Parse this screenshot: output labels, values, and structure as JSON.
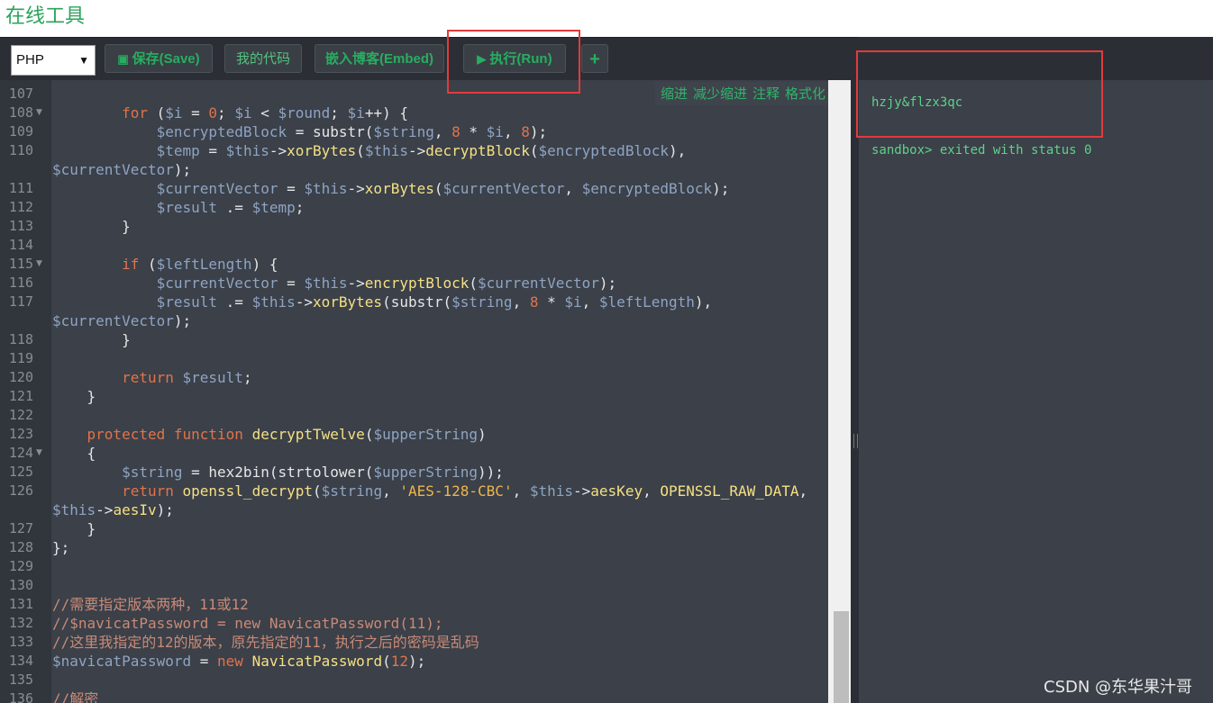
{
  "header": {
    "site_title": "在线工具"
  },
  "toolbar": {
    "language_selected": "PHP",
    "save_label": "保存(Save)",
    "mycode_label": "我的代码",
    "embed_label": "嵌入博客(Embed)",
    "run_label": "执行(Run)",
    "add_label": "+"
  },
  "editor_tools": [
    "缩进",
    "减少缩进",
    "注释",
    "格式化"
  ],
  "editor": {
    "lines": [
      {
        "n": "107",
        "fold": false,
        "html": ""
      },
      {
        "n": "108",
        "fold": true,
        "html": "        <span class=\"kw\">for</span> (<span class=\"var\">$i</span> = <span class=\"num\">0</span>; <span class=\"var\">$i</span> &lt; <span class=\"var\">$round</span>; <span class=\"var\">$i</span>++) {"
      },
      {
        "n": "109",
        "fold": false,
        "html": "            <span class=\"var\">$encryptedBlock</span> = substr(<span class=\"var\">$string</span>, <span class=\"num\">8</span> * <span class=\"var\">$i</span>, <span class=\"num\">8</span>);"
      },
      {
        "n": "110",
        "fold": false,
        "html": "            <span class=\"var\">$temp</span> = <span class=\"var\">$this</span>-&gt;<span class=\"fn\">xorBytes</span>(<span class=\"var\">$this</span>-&gt;<span class=\"fn\">decryptBlock</span>(<span class=\"var\">$encryptedBlock</span>),"
      },
      {
        "n": "",
        "fold": false,
        "html": "<span class=\"var\">$currentVector</span>);"
      },
      {
        "n": "111",
        "fold": false,
        "html": "            <span class=\"var\">$currentVector</span> = <span class=\"var\">$this</span>-&gt;<span class=\"fn\">xorBytes</span>(<span class=\"var\">$currentVector</span>, <span class=\"var\">$encryptedBlock</span>);"
      },
      {
        "n": "112",
        "fold": false,
        "html": "            <span class=\"var\">$result</span> .= <span class=\"var\">$temp</span>;"
      },
      {
        "n": "113",
        "fold": false,
        "html": "        }"
      },
      {
        "n": "114",
        "fold": false,
        "html": ""
      },
      {
        "n": "115",
        "fold": true,
        "html": "        <span class=\"kw\">if</span> (<span class=\"var\">$leftLength</span>) {"
      },
      {
        "n": "116",
        "fold": false,
        "html": "            <span class=\"var\">$currentVector</span> = <span class=\"var\">$this</span>-&gt;<span class=\"fn\">encryptBlock</span>(<span class=\"var\">$currentVector</span>);"
      },
      {
        "n": "117",
        "fold": false,
        "html": "            <span class=\"var\">$result</span> .= <span class=\"var\">$this</span>-&gt;<span class=\"fn\">xorBytes</span>(substr(<span class=\"var\">$string</span>, <span class=\"num\">8</span> * <span class=\"var\">$i</span>, <span class=\"var\">$leftLength</span>),"
      },
      {
        "n": "",
        "fold": false,
        "html": "<span class=\"var\">$currentVector</span>);"
      },
      {
        "n": "118",
        "fold": false,
        "html": "        }"
      },
      {
        "n": "119",
        "fold": false,
        "html": ""
      },
      {
        "n": "120",
        "fold": false,
        "html": "        <span class=\"kw\">return</span> <span class=\"var\">$result</span>;"
      },
      {
        "n": "121",
        "fold": false,
        "html": "    }"
      },
      {
        "n": "122",
        "fold": false,
        "html": ""
      },
      {
        "n": "123",
        "fold": false,
        "html": "    <span class=\"kw\">protected</span> <span class=\"kw\">function</span> <span class=\"fn\">decryptTwelve</span>(<span class=\"var\">$upperString</span>)"
      },
      {
        "n": "124",
        "fold": true,
        "html": "    {"
      },
      {
        "n": "125",
        "fold": false,
        "html": "        <span class=\"var\">$string</span> = hex2bin(strtolower(<span class=\"var\">$upperString</span>));"
      },
      {
        "n": "126",
        "fold": false,
        "html": "        <span class=\"kw\">return</span> <span class=\"fn\">openssl_decrypt</span>(<span class=\"var\">$string</span>, <span class=\"str\">'AES-128-CBC'</span>, <span class=\"var\">$this</span>-&gt;<span class=\"fn\">aesKey</span>, <span class=\"fn\">OPENSSL_RAW_DATA</span>,"
      },
      {
        "n": "",
        "fold": false,
        "html": "<span class=\"var\">$this</span>-&gt;<span class=\"fn\">aesIv</span>);"
      },
      {
        "n": "127",
        "fold": false,
        "html": "    }"
      },
      {
        "n": "128",
        "fold": false,
        "html": "};"
      },
      {
        "n": "129",
        "fold": false,
        "html": ""
      },
      {
        "n": "130",
        "fold": false,
        "html": ""
      },
      {
        "n": "131",
        "fold": false,
        "html": "<span class=\"cmt\">//需要指定版本两种，11或12</span>"
      },
      {
        "n": "132",
        "fold": false,
        "html": "<span class=\"cmt\">//$navicatPassword = new NavicatPassword(11);</span>"
      },
      {
        "n": "133",
        "fold": false,
        "html": "<span class=\"cmt\">//这里我指定的12的版本，原先指定的11，执行之后的密码是乱码</span>"
      },
      {
        "n": "134",
        "fold": false,
        "html": "<span class=\"var\">$navicatPassword</span> = <span class=\"kw\">new</span> <span class=\"fn\">NavicatPassword</span>(<span class=\"num\">12</span>);"
      },
      {
        "n": "135",
        "fold": false,
        "html": ""
      },
      {
        "n": "136",
        "fold": false,
        "html": "<span class=\"cmt\">//解密</span>"
      }
    ]
  },
  "output": {
    "result_line": "hzjy&flzx3qc",
    "status_line": "sandbox> exited with status 0"
  },
  "watermark": "CSDN @东华果汁哥",
  "colors": {
    "accent": "#27ae60",
    "highlight_box": "#e23b3b",
    "editor_bg": "#3b4049"
  }
}
